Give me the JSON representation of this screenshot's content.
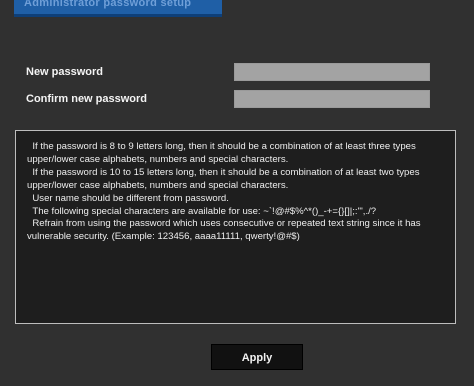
{
  "header": {
    "title": "Administrator password setup"
  },
  "form": {
    "new_password_label": "New password",
    "new_password_value": "",
    "confirm_password_label": "Confirm new password",
    "confirm_password_value": ""
  },
  "notes": {
    "lines": [
      "  If the password is 8 to 9 letters long, then it should be a combination of at least three types upper/lower case alphabets, numbers and special characters.",
      "  If the password is 10 to 15 letters long, then it should be a combination of at least two types upper/lower case alphabets, numbers and special characters.",
      "  User name should be different from password.",
      "  The following special characters are available for use: ~`!@#$%^*()_-+={}[]|;:'\",./?",
      "  Refrain from using the password which uses consecutive or repeated text string since it has vulnerable security. (Example: 123456, aaaa11111, qwerty!@#$)"
    ]
  },
  "actions": {
    "apply_label": "Apply"
  },
  "colors": {
    "background": "#303030",
    "title_bar": "#1f5fa6",
    "input_fill": "#a3a3a3",
    "button_fill": "#111111"
  }
}
